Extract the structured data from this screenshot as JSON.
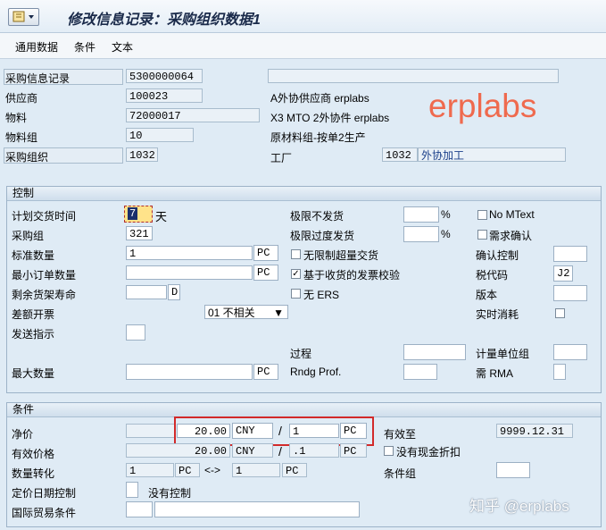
{
  "window": {
    "title": "修改信息记录：采购组织数据1"
  },
  "toolbar": {
    "items": [
      "通用数据",
      "条件",
      "文本"
    ]
  },
  "header": {
    "info_record_label": "采购信息记录",
    "info_record_value": "5300000064",
    "vendor_label": "供应商",
    "vendor_value": "100023",
    "vendor_desc": "A外协供应商 erplabs",
    "material_label": "物料",
    "material_value": "72000017",
    "material_desc": "X3 MTO 2外协件 erplabs",
    "matgroup_label": "物料组",
    "matgroup_value": "10",
    "matgroup_desc": "原材料组-按单2生产",
    "purch_org_label": "采购组织",
    "purch_org_value": "1032",
    "plant_label": "工厂",
    "plant_value": "1032",
    "plant_desc": "外协加工"
  },
  "watermark": "erplabs",
  "control": {
    "title": "控制",
    "planned_delivery_label": "计划交货时间",
    "planned_delivery_value": "7",
    "planned_delivery_unit": "天",
    "purch_group_label": "采购组",
    "purch_group_value": "321",
    "std_qty_label": "标准数量",
    "std_qty_value": "1",
    "std_qty_unit": "PC",
    "min_order_label": "最小订单数量",
    "min_order_unit": "PC",
    "shelf_life_label": "剩余货架寿命",
    "shelf_life_unit": "D",
    "tolerance_label": "差额开票",
    "tolerance_value": "01 不相关",
    "shipping_label": "发送指示",
    "max_qty_label": "最大数量",
    "max_qty_unit": "PC",
    "under_label": "极限不发货",
    "under_unit": "%",
    "over_label": "极限过度发货",
    "over_unit": "%",
    "unlimited_label": "无限制超量交货",
    "unlimited_checked": false,
    "gr_iv_label": "基于收货的发票校验",
    "gr_iv_checked": true,
    "no_ers_label": "无 ERS",
    "no_ers_checked": false,
    "process_label": "过程",
    "rndg_label": "Rndg Prof.",
    "no_mtext_label": "No MText",
    "no_mtext_checked": false,
    "ack_req_label": "需求确认",
    "ack_req_checked": false,
    "conf_ctrl_label": "确认控制",
    "tax_code_label": "税代码",
    "tax_code_value": "J2",
    "version_label": "版本",
    "rt_consume_label": "实时消耗",
    "uom_group_label": "计量单位组",
    "rma_label": "需 RMA"
  },
  "conditions": {
    "title": "条件",
    "net_price_label": "净价",
    "net_price_value": "20.00",
    "net_price_currency": "CNY",
    "slash": "/",
    "per_value": "1",
    "per_unit": "PC",
    "valid_to_label": "有效至",
    "valid_to_value": "9999.12.31",
    "eff_price_label": "有效价格",
    "eff_price_value": "20.00",
    "eff_price_currency": "CNY",
    "eff_per_value": ".1",
    "eff_per_unit": "PC",
    "no_cash_label": "没有现金折扣",
    "conv_label": "数量转化",
    "conv_from": "1",
    "conv_from_unit": "PC",
    "conv_arrow": "<->",
    "conv_to": "1",
    "conv_to_unit": "PC",
    "cond_group_label": "条件组",
    "pricing_date_label": "定价日期控制",
    "pricing_date_text": "没有控制",
    "incoterms_label": "国际贸易条件"
  },
  "footer_watermark": "知乎 @erplabs"
}
